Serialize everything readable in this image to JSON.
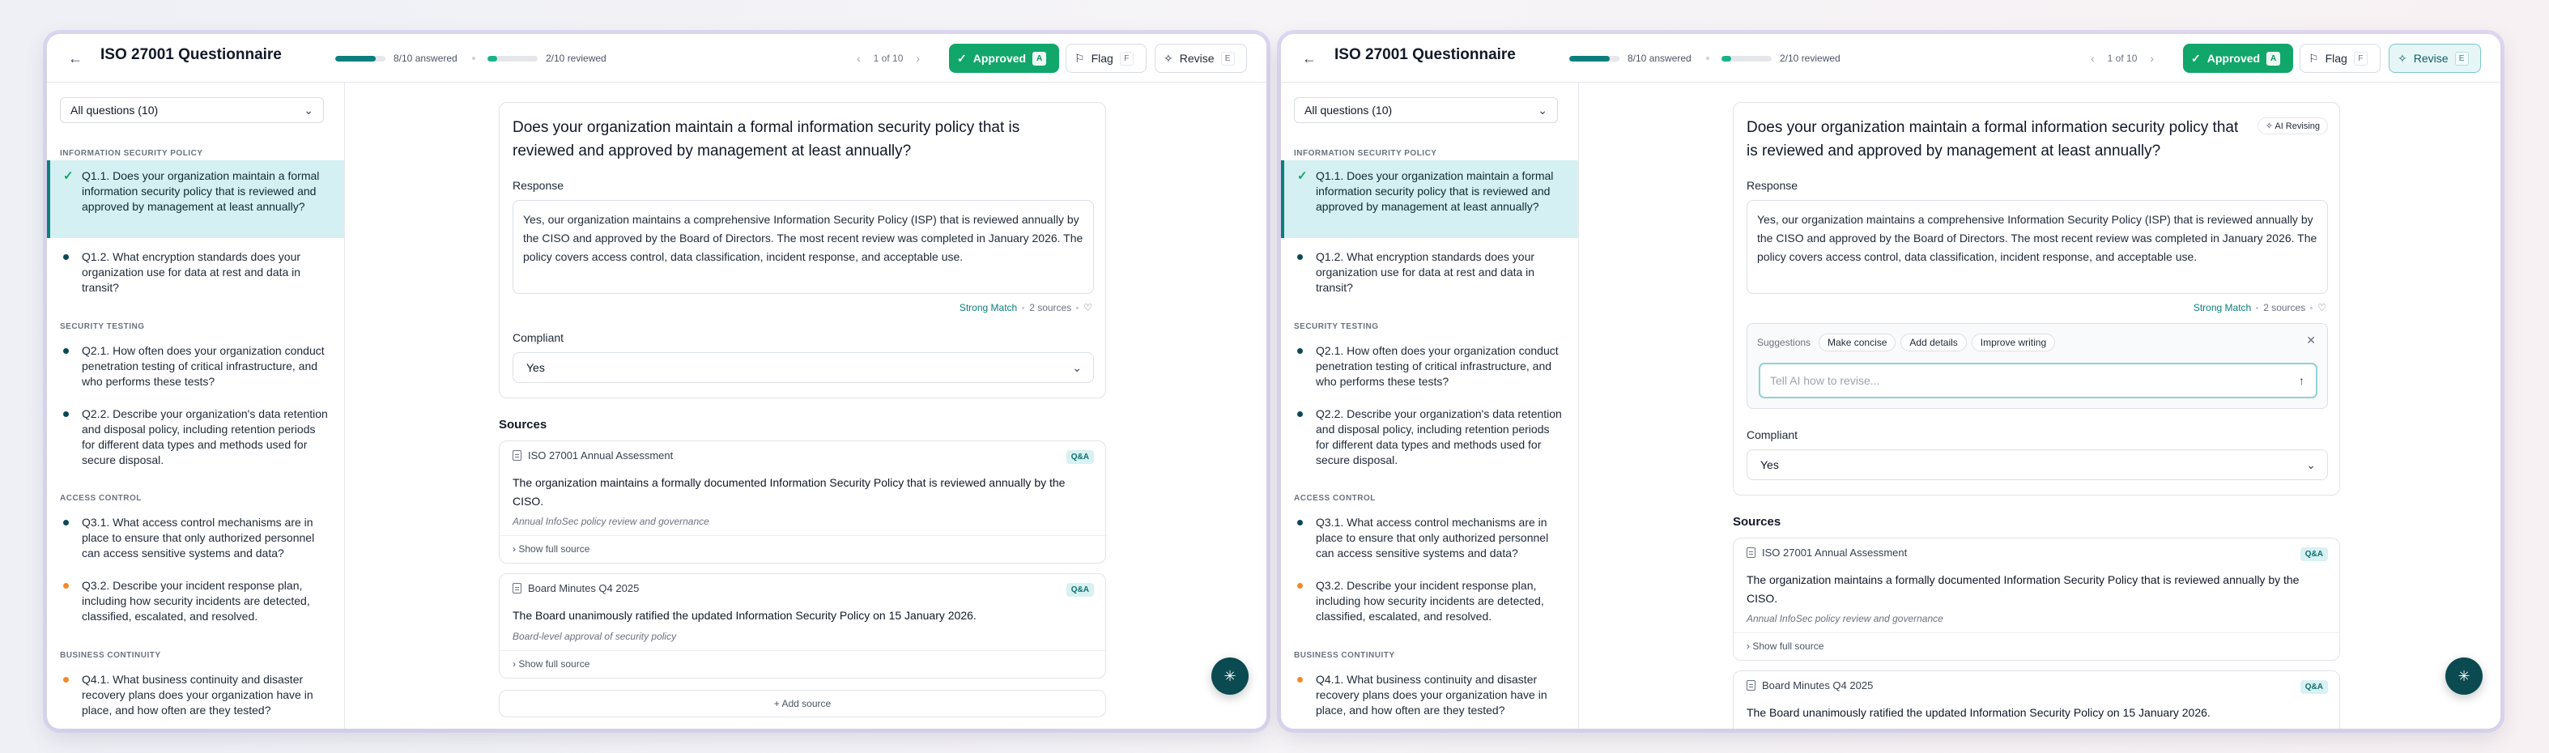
{
  "header": {
    "title": "ISO 27001 Questionnaire",
    "answered_label": "8/10 answered",
    "answered_fraction": 0.8,
    "reviewed_label": "2/10 reviewed",
    "reviewed_fraction": 0.2,
    "pager": "1 of 10",
    "approved_label": "Approved",
    "approved_key": "A",
    "flag_label": "Flag",
    "flag_key": "F",
    "revise_label": "Revise",
    "revise_key": "E"
  },
  "sidebar": {
    "filter_value": "All questions (10)",
    "sections": [
      {
        "title": "INFORMATION SECURITY POLICY"
      },
      {
        "title": "SECURITY TESTING"
      },
      {
        "title": "ACCESS CONTROL"
      },
      {
        "title": "BUSINESS CONTINUITY"
      }
    ],
    "questions": [
      {
        "text": "Q1.1. Does your organization maintain a formal information security policy that is reviewed and approved by management at least annually?",
        "status": "approved"
      },
      {
        "text": "Q1.2. What encryption standards does your organization use for data at rest and data in transit?",
        "status": "answered"
      },
      {
        "text": "Q2.1. How often does your organization conduct penetration testing of critical infrastructure, and who performs these tests?",
        "status": "answered"
      },
      {
        "text": "Q2.2. Describe your organization's data retention and disposal policy, including retention periods for different data types and methods used for secure disposal.",
        "status": "answered"
      },
      {
        "text": "Q3.1. What access control mechanisms are in place to ensure that only authorized personnel can access sensitive systems and data?",
        "status": "answered"
      },
      {
        "text": "Q3.2. Describe your incident response plan, including how security incidents are detected, classified, escalated, and resolved.",
        "status": "pending"
      },
      {
        "text": "Q4.1. What business continuity and disaster recovery plans does your organization have in place, and how often are they tested?",
        "status": "pending"
      }
    ]
  },
  "question": {
    "text": "Does your organization maintain a formal information security policy that is reviewed and approved by management at least annually?",
    "response_label": "Response",
    "response": "Yes, our organization maintains a comprehensive Information Security Policy (ISP) that is reviewed annually by the CISO and approved by the Board of Directors. The most recent review was completed in January 2026. The policy covers access control, data classification, incident response, and acceptable use.",
    "match": "Strong Match",
    "sources_count": "2 sources",
    "compliant_label": "Compliant",
    "compliant_value": "Yes",
    "ai_revising": "AI Revising"
  },
  "revise": {
    "suggestions_label": "Suggestions",
    "chips": [
      "Make concise",
      "Add details",
      "Improve writing"
    ],
    "placeholder": "Tell AI how to revise..."
  },
  "sources": {
    "heading": "Sources",
    "items": [
      {
        "title": "ISO 27001 Annual Assessment",
        "tag": "Q&A",
        "text": "The organization maintains a formally documented Information Security Policy that is reviewed annually by the CISO.",
        "subtitle": "Annual InfoSec policy review and governance",
        "show": "Show full source"
      },
      {
        "title": "Board Minutes Q4 2025",
        "tag": "Q&A",
        "text": "The Board unanimously ratified the updated Information Security Policy on 15 January 2026.",
        "subtitle": "Board-level approval of security policy",
        "show": "Show full source"
      }
    ],
    "add_label": "+ Add source"
  },
  "colors": {
    "accent": "#0b7f7d",
    "approved": "#11a66a",
    "pending": "#f08b2a"
  },
  "icons": [
    "back-arrow-icon",
    "chevron-left-icon",
    "chevron-right-icon",
    "check-icon",
    "flag-icon",
    "sparkle-icon",
    "chevron-down-icon",
    "document-icon",
    "close-icon",
    "arrow-up-icon"
  ]
}
